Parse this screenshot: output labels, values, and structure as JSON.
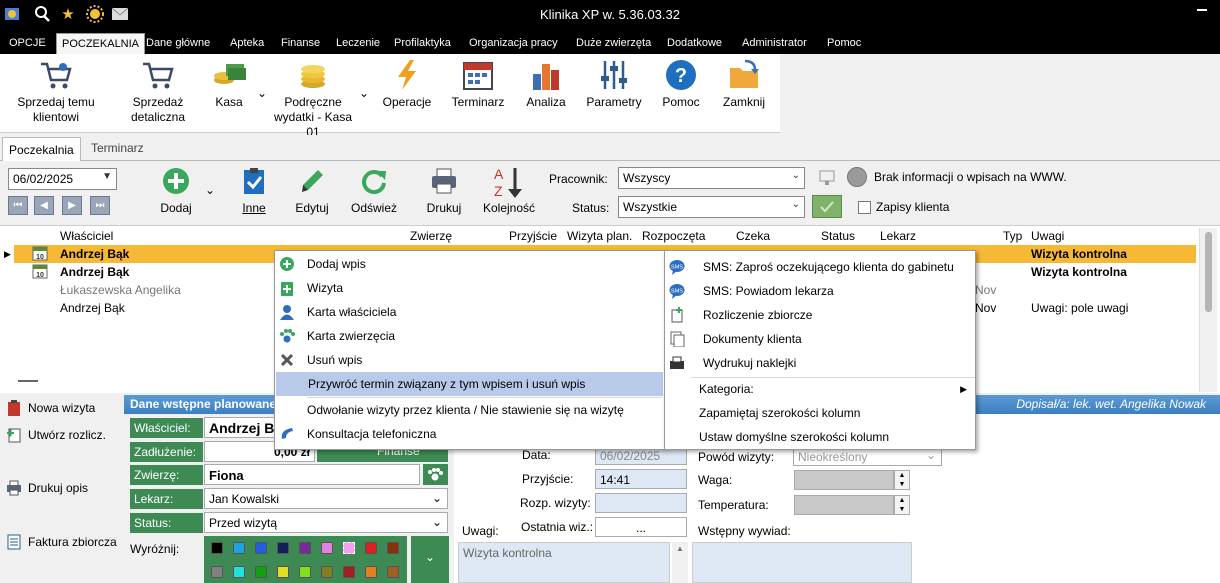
{
  "app": {
    "title": "Klinika XP w. 5.36.03.32"
  },
  "menubar": [
    "OPCJE",
    "POCZEKALNIA",
    "Dane główne",
    "Apteka",
    "Finanse",
    "Leczenie",
    "Profilaktyka",
    "Organizacja pracy",
    "Duże zwierzęta",
    "Dodatkowe",
    "Administrator",
    "Pomoc"
  ],
  "ribbon": {
    "sprzedaj_l1": "Sprzedaj temu",
    "sprzedaj_l2": "klientowi",
    "detal_l1": "Sprzedaż",
    "detal_l2": "detaliczna",
    "kasa": "Kasa",
    "podreczne_l1": "Podręczne",
    "podreczne_l2": "wydatki - Kasa",
    "podreczne_l3": "01",
    "operacje": "Operacje",
    "terminarz": "Terminarz",
    "analiza": "Analiza",
    "parametry": "Parametry",
    "pomoc": "Pomoc",
    "zamknij": "Zamknij"
  },
  "tabs": {
    "poczekalnia": "Poczekalnia",
    "terminarz": "Terminarz"
  },
  "toolbar": {
    "date": "06/02/2025",
    "dodaj": "Dodaj",
    "inne": "Inne",
    "edytuj": "Edytuj",
    "odswiez": "Odśwież",
    "drukuj": "Drukuj",
    "kolejnosc": "Kolejność",
    "pracownik_label": "Pracownik:",
    "pracownik_value": "Wszyscy",
    "status_label": "Status:",
    "status_value": "Wszystkie",
    "www_info": "Brak informacji o wpisach na WWW.",
    "zapisy_klienta": "Zapisy klienta",
    "calendar_day": "10"
  },
  "grid": {
    "columns": [
      "Właściciel",
      "Zwierzę",
      "Przyjście",
      "Wizyta plan.",
      "Rozpoczęta",
      "Czeka",
      "Status",
      "Lekarz",
      "Typ",
      "Uwagi"
    ],
    "rows": [
      {
        "owner": "Andrzej Bąk",
        "typ": "",
        "uwagi": "Wizyta kontrolna"
      },
      {
        "owner": "Andrzej Bąk",
        "typ": "",
        "uwagi": "Wizyta kontrolna"
      },
      {
        "owner": "Łukaszewska Angelika",
        "typ": "Nov",
        "uwagi": ""
      },
      {
        "owner": "Andrzej Bąk",
        "typ": "Nov",
        "uwagi": "Uwagi: pole uwagi"
      }
    ]
  },
  "leftpanel": {
    "nowa": "Nowa wizyta",
    "utworz": "Utwórz rozlicz.",
    "drukuj": "Drukuj opis",
    "faktura": "Faktura zbiorcza"
  },
  "detail": {
    "header_left": "Dane wstępne planowane",
    "header_right": "Dopisał/a: lek. wet. Angelika Nowak"
  },
  "form": {
    "wlasciciel_label": "Właściciel:",
    "wlasciciel_value": "Andrzej Ba",
    "zadluzenie_label": "Zadłużenie:",
    "zadluzenie_value": "0,00 zł",
    "finanse": "Finanse",
    "zwierze_label": "Zwierzę:",
    "zwierze_value": "Fiona",
    "lekarz_label": "Lekarz:",
    "lekarz_value": "Jan Kowalski",
    "status_label": "Status:",
    "status_value": "Przed wizytą",
    "wyroznij_label": "Wyróżnij:"
  },
  "form_right": {
    "data_label": "Data:",
    "data_value": "06/02/2025",
    "przyjscie_label": "Przyjście:",
    "przyjscie_value": "14:41",
    "rozp_label": "Rozp. wizyty:",
    "uwagi_label": "Uwagi:",
    "ostatnia_label": "Ostatnia wiz.:",
    "ostatnia_btn": "...",
    "uwagi_text": "Wizyta kontrolna",
    "powod_label": "Powód wizyty:",
    "powod_value": "Nieokreślony",
    "waga_label": "Waga:",
    "temp_label": "Temperatura:",
    "wywiad_label": "Wstępny wywiad:"
  },
  "context_menu_left": [
    "Dodaj wpis",
    "Wizyta",
    "Karta właściciela",
    "Karta zwierzęcia",
    "Usuń wpis",
    "Przywróć termin związany z tym wpisem i usuń wpis",
    "Odwołanie wizyty przez klienta / Nie stawienie się na wizytę",
    "Konsultacja telefoniczna"
  ],
  "context_menu_right": [
    "SMS: Zaproś oczekującego klienta do gabinetu",
    "SMS: Powiadom lekarza",
    "Rozliczenie zbiorcze",
    "Dokumenty klienta",
    "Wydrukuj naklejki",
    "Kategoria:",
    "Zapamiętaj szerokości kolumn",
    "Ustaw domyślne szerokości kolumn"
  ],
  "colors": {
    "accent_green": "#3d8a54",
    "highlight_row": "#f5b935",
    "menu_highlight": "#b9c9e9",
    "header_blue": "#3d7fc0"
  }
}
